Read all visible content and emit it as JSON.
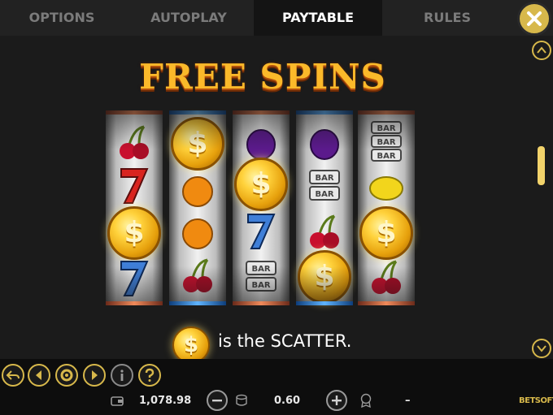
{
  "tabs": [
    {
      "label": "OPTIONS",
      "active": false
    },
    {
      "label": "AUTOPLAY",
      "active": false
    },
    {
      "label": "PAYTABLE",
      "active": true
    },
    {
      "label": "RULES",
      "active": false
    }
  ],
  "close_icon": "close-icon",
  "paytable": {
    "title": "FREE SPINS",
    "scatter_text": "is the SCATTER.",
    "reels": [
      {
        "frame": "red",
        "symbols": [
          "cherry",
          "seven",
          "scatter-coin",
          "seven"
        ]
      },
      {
        "frame": "blue",
        "symbols": [
          "scatter-coin",
          "orange",
          "orange",
          "cherry"
        ]
      },
      {
        "frame": "red",
        "symbols": [
          "plum",
          "scatter-coin",
          "seven",
          "bar-bar"
        ]
      },
      {
        "frame": "blue",
        "symbols": [
          "plum",
          "bar-bar",
          "cherry",
          "scatter-coin"
        ]
      },
      {
        "frame": "red",
        "symbols": [
          "bar-bar-bar",
          "lemon",
          "scatter-coin",
          "cherry"
        ]
      }
    ],
    "bar_label": "BAR"
  },
  "bottom_bar": {
    "balance": "1,078.98",
    "bet": "0.60",
    "win": "–",
    "logo": "BETSOFT",
    "controls": [
      "back-arrow-icon",
      "previous-icon",
      "settings-icon",
      "next-icon",
      "info-icon",
      "help-icon"
    ]
  },
  "colors": {
    "accent": "#d7b84b",
    "title_gold": "#fbb92a",
    "background": "#1b1b1b"
  }
}
